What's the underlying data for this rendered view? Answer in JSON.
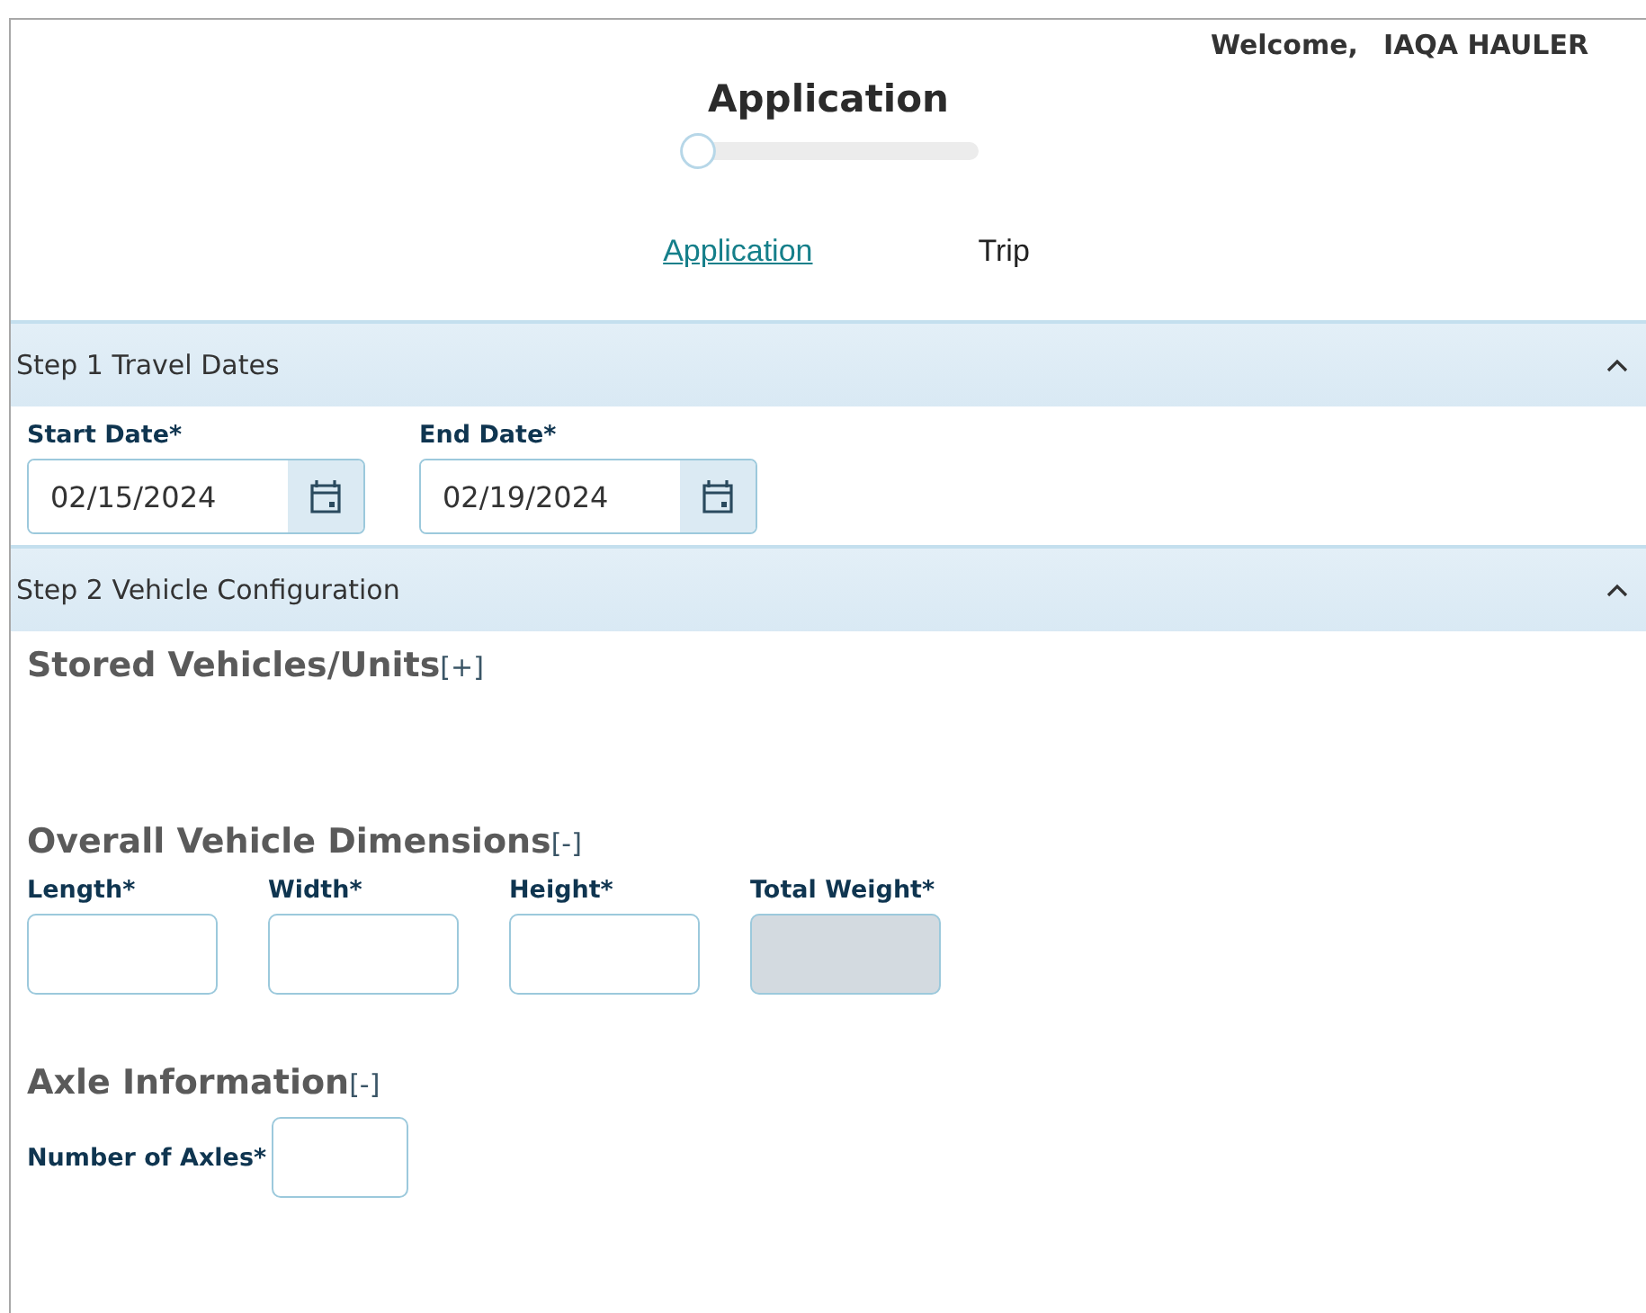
{
  "header": {
    "welcome_label": "Welcome,",
    "user_name": "IAQA HAULER",
    "title": "Application",
    "progress": {
      "level": 0
    },
    "tabs": [
      {
        "label": "Application",
        "selected": true
      },
      {
        "label": "Trip",
        "selected": false
      }
    ]
  },
  "sections": [
    {
      "title": "Step 1 Travel Dates",
      "expanded": true,
      "kind": "dates",
      "fields": [
        {
          "label": "Start Date*",
          "value": "02/15/2024"
        },
        {
          "label": "End Date*",
          "value": "02/19/2024"
        }
      ]
    },
    {
      "title": "Step 2 Vehicle Configuration",
      "expanded": true,
      "kind": "groups",
      "groups": [
        {
          "title": "Stored Vehicles/Units",
          "toggle": "[+]",
          "kind": "grid"
        },
        {
          "title": "Overall Vehicle Dimensions",
          "toggle": "[-]",
          "kind": "grid",
          "fields": [
            {
              "label": "Length*",
              "disabled": false
            },
            {
              "label": "Width*",
              "disabled": false
            },
            {
              "label": "Height*",
              "disabled": false
            },
            {
              "label": "Total Weight*",
              "disabled": true
            }
          ]
        },
        {
          "title": "Axle Information",
          "toggle": "[-]",
          "kind": "inline",
          "fields": [
            {
              "label": "Number of Axles*",
              "disabled": false
            }
          ]
        }
      ]
    }
  ]
}
